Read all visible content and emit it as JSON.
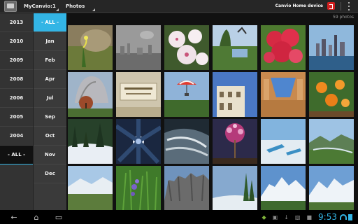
{
  "actionbar": {
    "device_label": "MyCanvio:1",
    "photos_label": "Photos",
    "home_device_label": "Canvio Home device"
  },
  "years": {
    "items": [
      "2013",
      "2010",
      "2009",
      "2008",
      "2006",
      "2005",
      "2004",
      "- ALL -"
    ],
    "selected": "- ALL -"
  },
  "months": {
    "items": [
      "- ALL -",
      "Jan",
      "Feb",
      "Apr",
      "Jul",
      "Sep",
      "Oct",
      "Nov",
      "Dec"
    ],
    "selected": "- ALL -"
  },
  "grid": {
    "photo_count": "59 photos"
  },
  "statusbar": {
    "time": "9:53"
  },
  "colors": {
    "accent": "#33b5e5",
    "exit_button": "#d21f1f"
  },
  "icons": {
    "app": "app-icon",
    "exit": "exit-icon",
    "overflow": "overflow-menu-icon",
    "back": "back-icon",
    "home": "home-icon",
    "recents": "recents-icon"
  }
}
